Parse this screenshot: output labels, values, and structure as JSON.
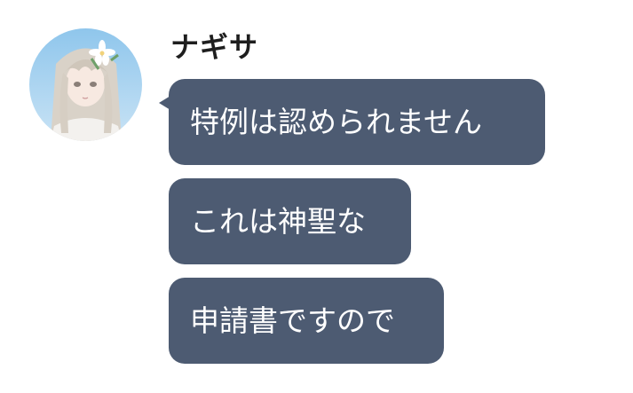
{
  "sender": {
    "name": "ナギサ",
    "avatar_icon": "avatar-portrait-icon"
  },
  "messages": [
    {
      "text": "特例は認められません"
    },
    {
      "text": "これは神聖な"
    },
    {
      "text": "申請書ですので"
    }
  ],
  "colors": {
    "bubble": "#4d5b72",
    "bubble_text": "#ffffff",
    "name_text": "#1e1e1e",
    "background": "#ffffff"
  }
}
